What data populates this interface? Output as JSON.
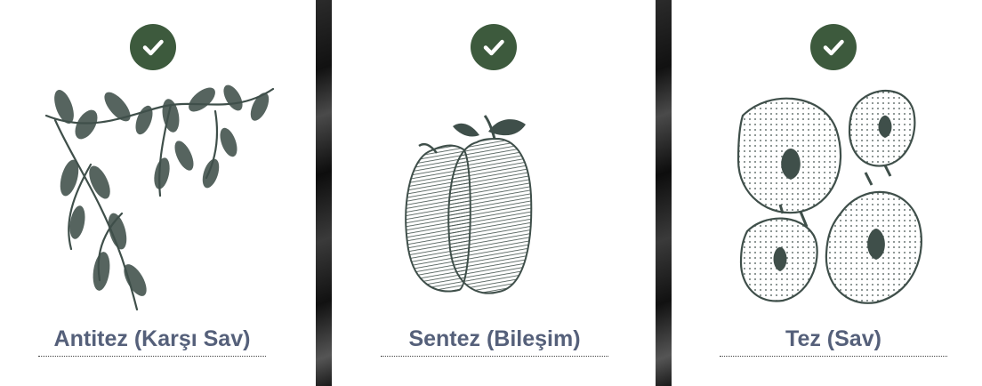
{
  "cards": [
    {
      "title": "Antitez (Karşı Sav)",
      "icon": "leafy-branch-illustration",
      "checked": true
    },
    {
      "title": "Sentez (Bileşim)",
      "icon": "two-apples-illustration",
      "checked": true
    },
    {
      "title": "Tez (Sav)",
      "icon": "apple-halves-illustration",
      "checked": true
    }
  ],
  "colors": {
    "check_bg": "#3d5a3d",
    "title": "#55607a",
    "ink": "#3f4f4a"
  }
}
